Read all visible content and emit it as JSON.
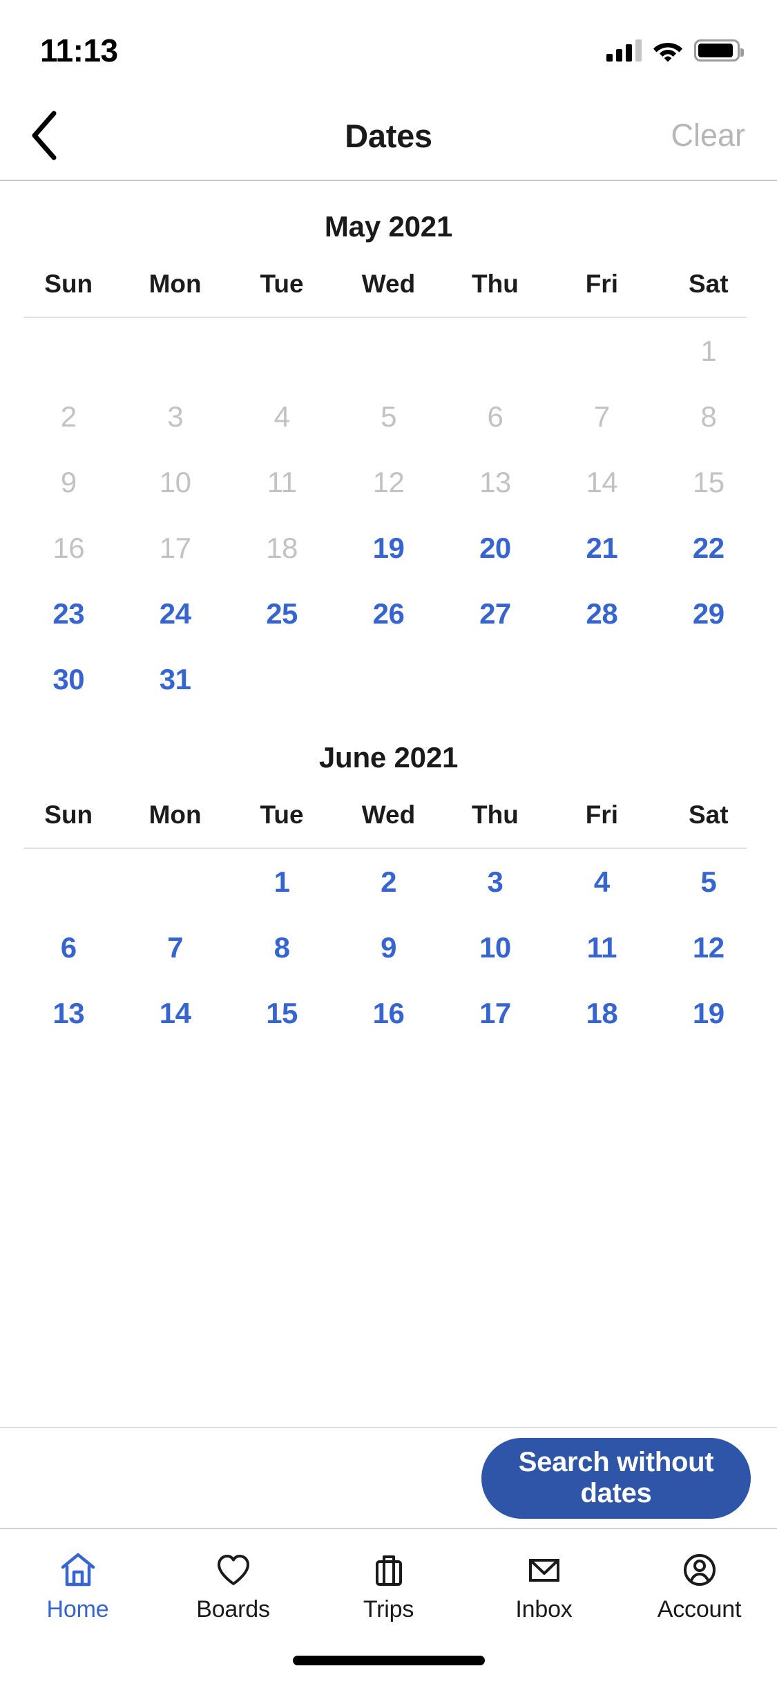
{
  "status_bar": {
    "time": "11:13",
    "signal_icon": "cellular-signal-icon",
    "signal_bars_filled": 3,
    "signal_bars_total": 4,
    "wifi_icon": "wifi-icon",
    "battery_icon": "battery-icon",
    "battery_level_pct": 92
  },
  "nav_bar": {
    "back_icon": "chevron-left-icon",
    "title": "Dates",
    "clear_label": "Clear"
  },
  "theme": {
    "accent_blue": "#3665D0",
    "cta_blue": "#2F55A8",
    "disabled_gray": "#c2c2c2",
    "text_black": "#1a1a1a",
    "clear_gray": "#b6b6b6",
    "divider_gray": "#e0e0e0"
  },
  "calendar": {
    "weekday_labels": [
      "Sun",
      "Mon",
      "Tue",
      "Wed",
      "Thu",
      "Fri",
      "Sat"
    ],
    "months": [
      {
        "title": "May 2021",
        "lead_blanks": 6,
        "days": [
          {
            "n": "1",
            "state": "disabled"
          },
          {
            "n": "2",
            "state": "disabled"
          },
          {
            "n": "3",
            "state": "disabled"
          },
          {
            "n": "4",
            "state": "disabled"
          },
          {
            "n": "5",
            "state": "disabled"
          },
          {
            "n": "6",
            "state": "disabled"
          },
          {
            "n": "7",
            "state": "disabled"
          },
          {
            "n": "8",
            "state": "disabled"
          },
          {
            "n": "9",
            "state": "disabled"
          },
          {
            "n": "10",
            "state": "disabled"
          },
          {
            "n": "11",
            "state": "disabled"
          },
          {
            "n": "12",
            "state": "disabled"
          },
          {
            "n": "13",
            "state": "disabled"
          },
          {
            "n": "14",
            "state": "disabled"
          },
          {
            "n": "15",
            "state": "disabled"
          },
          {
            "n": "16",
            "state": "disabled"
          },
          {
            "n": "17",
            "state": "disabled"
          },
          {
            "n": "18",
            "state": "disabled"
          },
          {
            "n": "19",
            "state": "enabled"
          },
          {
            "n": "20",
            "state": "enabled"
          },
          {
            "n": "21",
            "state": "enabled"
          },
          {
            "n": "22",
            "state": "enabled"
          },
          {
            "n": "23",
            "state": "enabled"
          },
          {
            "n": "24",
            "state": "enabled"
          },
          {
            "n": "25",
            "state": "enabled"
          },
          {
            "n": "26",
            "state": "enabled"
          },
          {
            "n": "27",
            "state": "enabled"
          },
          {
            "n": "28",
            "state": "enabled"
          },
          {
            "n": "29",
            "state": "enabled"
          },
          {
            "n": "30",
            "state": "enabled"
          },
          {
            "n": "31",
            "state": "enabled"
          }
        ]
      },
      {
        "title": "June 2021",
        "lead_blanks": 2,
        "days": [
          {
            "n": "1",
            "state": "enabled"
          },
          {
            "n": "2",
            "state": "enabled"
          },
          {
            "n": "3",
            "state": "enabled"
          },
          {
            "n": "4",
            "state": "enabled"
          },
          {
            "n": "5",
            "state": "enabled"
          },
          {
            "n": "6",
            "state": "enabled"
          },
          {
            "n": "7",
            "state": "enabled"
          },
          {
            "n": "8",
            "state": "enabled"
          },
          {
            "n": "9",
            "state": "enabled"
          },
          {
            "n": "10",
            "state": "enabled"
          },
          {
            "n": "11",
            "state": "enabled"
          },
          {
            "n": "12",
            "state": "enabled"
          },
          {
            "n": "13",
            "state": "enabled"
          },
          {
            "n": "14",
            "state": "enabled"
          },
          {
            "n": "15",
            "state": "enabled"
          },
          {
            "n": "16",
            "state": "enabled"
          },
          {
            "n": "17",
            "state": "enabled"
          },
          {
            "n": "18",
            "state": "enabled"
          },
          {
            "n": "19",
            "state": "enabled"
          }
        ]
      }
    ]
  },
  "cta": {
    "label": "Search without dates"
  },
  "tab_bar": {
    "items": [
      {
        "label": "Home",
        "icon": "home-icon",
        "active": true
      },
      {
        "label": "Boards",
        "icon": "heart-icon",
        "active": false
      },
      {
        "label": "Trips",
        "icon": "suitcase-icon",
        "active": false
      },
      {
        "label": "Inbox",
        "icon": "envelope-icon",
        "active": false
      },
      {
        "label": "Account",
        "icon": "person-circle-icon",
        "active": false
      }
    ]
  }
}
